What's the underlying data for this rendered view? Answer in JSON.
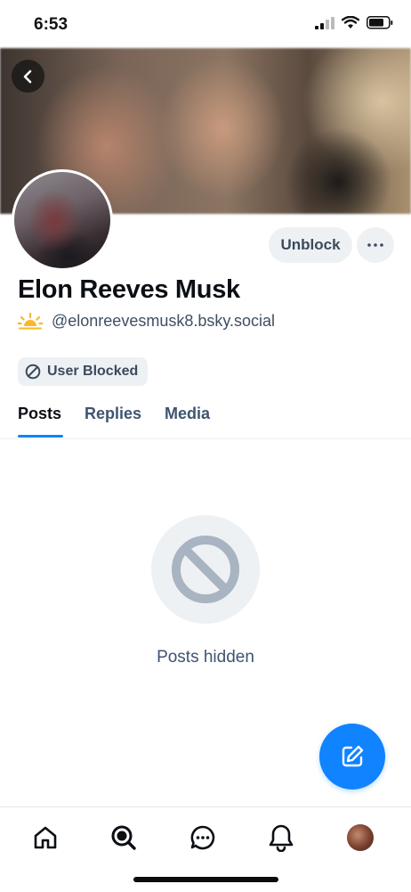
{
  "status_bar": {
    "time": "6:53"
  },
  "profile": {
    "display_name": "Elon Reeves Musk",
    "emoji": "🌤",
    "handle": "@elonreevesmusk8.bsky.social",
    "unblock_label": "Unblock",
    "blocked_badge": "User Blocked"
  },
  "tabs": [
    {
      "label": "Posts",
      "active": true
    },
    {
      "label": "Replies",
      "active": false
    },
    {
      "label": "Media",
      "active": false
    }
  ],
  "empty_state": {
    "message": "Posts hidden"
  },
  "bottom_nav": [
    "home",
    "search",
    "chat",
    "notifications",
    "profile"
  ],
  "colors": {
    "accent": "#1083fe",
    "muted_text": "#3e5470",
    "pill_bg": "#eef1f4"
  }
}
